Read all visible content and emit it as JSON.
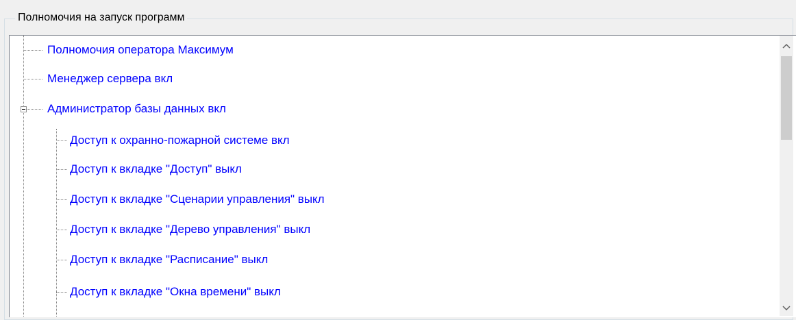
{
  "group": {
    "title": "Полномочия на запуск программ"
  },
  "tree": {
    "items": [
      {
        "label": "Полномочия оператора  Максимум"
      },
      {
        "label": "Менеджер сервера  вкл"
      },
      {
        "label": "Администратор базы данных  вкл"
      },
      {
        "label": "Доступ к охранно-пожарной системе  вкл"
      },
      {
        "label": "Доступ к вкладке \"Доступ\"  выкл"
      },
      {
        "label": "Доступ к вкладке \"Сценарии управления\"  выкл"
      },
      {
        "label": "Доступ к вкладке \"Дерево управления\"  выкл"
      },
      {
        "label": "Доступ к вкладке \"Расписание\"  выкл"
      },
      {
        "label": "Доступ к вкладке \"Окна времени\"  выкл"
      }
    ]
  },
  "scrollbar": {
    "up_icon": "chevron-up-icon",
    "down_icon": "chevron-down-icon"
  }
}
